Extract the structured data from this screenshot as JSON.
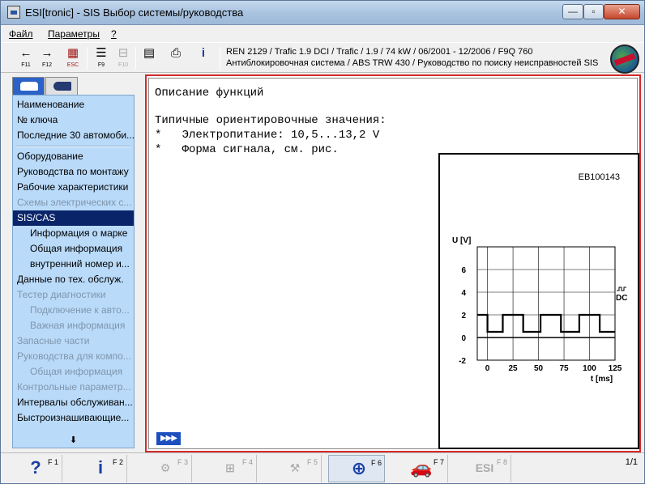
{
  "window": {
    "title": "ESI[tronic] - SIS Выбор системы/руководства",
    "minimize": "—",
    "maximize": "▫",
    "close": "✕"
  },
  "menu": {
    "file": "Файл",
    "params": "Параметры",
    "help": "?"
  },
  "toolbar": {
    "buttons": [
      {
        "icon": "arrow-back-icon",
        "glyph": "←",
        "label": "F11",
        "enabled": true
      },
      {
        "icon": "arrow-forward-icon",
        "glyph": "→",
        "label": "F12",
        "enabled": true
      },
      {
        "icon": "exit-icon",
        "glyph": "▦",
        "label": "ESC",
        "enabled": true
      },
      {
        "icon": "list-icon",
        "glyph": "☰",
        "label": "F9",
        "enabled": true
      },
      {
        "icon": "tree-icon",
        "glyph": "⊟",
        "label": "F10",
        "enabled": false
      },
      {
        "icon": "document-icon",
        "glyph": "▤",
        "label": "",
        "enabled": true
      },
      {
        "icon": "printer-icon",
        "glyph": "⎙",
        "label": "",
        "enabled": true
      },
      {
        "icon": "info-icon",
        "glyph": "i",
        "label": "",
        "enabled": true
      }
    ],
    "vehicle_line": "REN 2129 / Trafic 1.9 DCI / Trafic / 1.9 / 74 kW / 06/2001 - 12/2006 / F9Q 760",
    "system_line": "Антиблокировочная система / ABS TRW 430 / Руководство по поиску неисправностей SIS"
  },
  "nav": {
    "group1": [
      "Наименование",
      "№ ключа",
      "Последние 30 автомоби..."
    ],
    "group2": [
      {
        "label": "Оборудование",
        "state": "normal",
        "sub": false
      },
      {
        "label": "Руководства по монтажу",
        "state": "normal",
        "sub": false
      },
      {
        "label": "Рабочие характеристики",
        "state": "normal",
        "sub": false
      },
      {
        "label": "Схемы электрических с...",
        "state": "disabled",
        "sub": false
      },
      {
        "label": "SIS/CAS",
        "state": "selected",
        "sub": false
      },
      {
        "label": "Информация о марке",
        "state": "normal",
        "sub": true
      },
      {
        "label": "Общая информация",
        "state": "normal",
        "sub": true
      },
      {
        "label": "внутренний номер и...",
        "state": "normal",
        "sub": true
      },
      {
        "label": "Данные по тех. обслуж.",
        "state": "normal",
        "sub": false
      },
      {
        "label": "Тестер диагностики",
        "state": "disabled",
        "sub": false
      },
      {
        "label": "Подключение к авто...",
        "state": "disabled",
        "sub": true
      },
      {
        "label": "Важная информация",
        "state": "disabled",
        "sub": true
      },
      {
        "label": "Запасные части",
        "state": "disabled",
        "sub": false
      },
      {
        "label": "Руководства для компо...",
        "state": "disabled",
        "sub": false
      },
      {
        "label": "Общая информация",
        "state": "disabled",
        "sub": true
      },
      {
        "label": "Контрольные параметр...",
        "state": "disabled",
        "sub": false
      },
      {
        "label": "Интервалы обслуживан...",
        "state": "normal",
        "sub": false
      },
      {
        "label": "Быстроизнашивающие...",
        "state": "normal",
        "sub": false
      }
    ],
    "scroll_down": "⬇"
  },
  "content": {
    "heading": "Описание функций",
    "subheading": "Типичные ориентировочные значения:",
    "bullet1": "*   Электропитание: 10,5...13,2 V",
    "bullet2": "*   Форма сигнала, см. рис.",
    "forward_button": "▶▶▶",
    "figure_ref": "EB100143"
  },
  "chart_data": {
    "type": "line",
    "title": "",
    "xlabel": "t [ms]",
    "ylabel": "U [V]",
    "xlim": [
      -10,
      125
    ],
    "ylim": [
      -2,
      8
    ],
    "x_ticks": [
      0,
      25,
      50,
      75,
      100,
      125
    ],
    "y_ticks": [
      -2,
      0,
      2,
      4,
      6
    ],
    "grid": true,
    "annotation": "DC",
    "series": [
      {
        "x": [
          -10,
          0,
          0,
          15,
          15,
          35,
          35,
          52,
          52,
          72,
          72,
          90,
          90,
          110,
          110,
          125
        ],
        "y": [
          2,
          2,
          0.5,
          0.5,
          2,
          2,
          0.5,
          0.5,
          2,
          2,
          0.5,
          0.5,
          2,
          2,
          0.5,
          0.5
        ]
      }
    ]
  },
  "statusbar": {
    "keys": [
      {
        "icon": "help-icon",
        "glyph": "?",
        "fkey": "F 1",
        "enabled": true
      },
      {
        "icon": "info-icon",
        "glyph": "i",
        "fkey": "F 2",
        "enabled": true
      },
      {
        "icon": "circuit-icon",
        "glyph": "⚙",
        "fkey": "F 3",
        "enabled": false
      },
      {
        "icon": "wiring-icon",
        "glyph": "⊞",
        "fkey": "F 4",
        "enabled": false
      },
      {
        "icon": "component-icon",
        "glyph": "⚒",
        "fkey": "F 5",
        "enabled": false
      },
      {
        "icon": "zoom-icon",
        "glyph": "⊕",
        "fkey": "F 6",
        "enabled": true
      },
      {
        "icon": "vehicle-icon",
        "glyph": "🚗",
        "fkey": "F 7",
        "enabled": true
      },
      {
        "icon": "esi-icon",
        "glyph": "ESI",
        "fkey": "F 8",
        "enabled": false
      }
    ],
    "pager": "1/1"
  }
}
